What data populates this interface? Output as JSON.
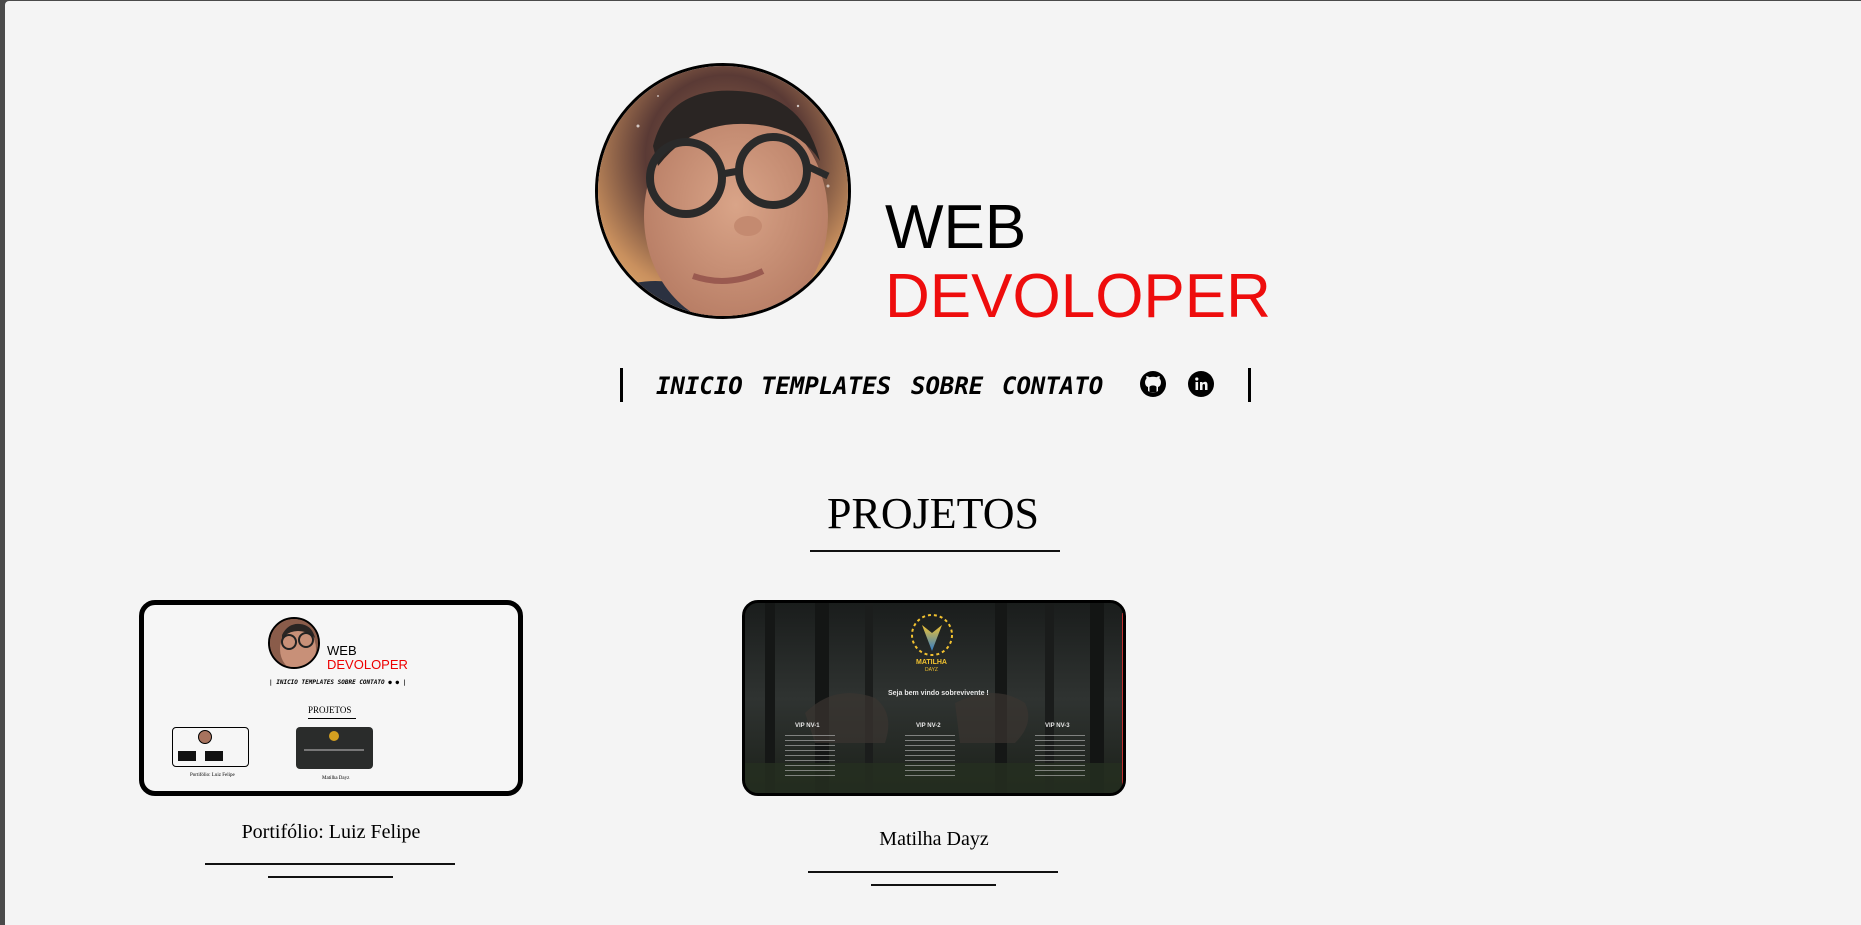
{
  "header": {
    "title_line1": "WEB",
    "title_line2": "DEVOLOPER",
    "accent_color": "#ee0d0d"
  },
  "nav": {
    "items": [
      "INICIO",
      "TEMPLATES",
      "SOBRE",
      "CONTATO"
    ],
    "icons": [
      "github-icon",
      "linkedin-icon"
    ]
  },
  "projects": {
    "heading": "PROJETOS",
    "cards": [
      {
        "caption": "Portifólio: Luiz Felipe",
        "preview": {
          "title_line1": "WEB",
          "title_line2": "DEVOLOPER",
          "nav": "INICIO TEMPLATES SOBRE CONTATO",
          "heading": "PROJETOS",
          "caption1": "Portifólio: Luiz Felipe",
          "caption2": "Matilha Dayz"
        }
      },
      {
        "caption": "Matilha Dayz",
        "preview": {
          "logo_text": "MATILHA",
          "logo_sub": "DAYZ",
          "welcome": "Seja bem vindo sobrevivente !",
          "vip1": "VIP NV-1",
          "vip2": "VIP NV-2",
          "vip3": "VIP NV-3"
        }
      }
    ]
  }
}
